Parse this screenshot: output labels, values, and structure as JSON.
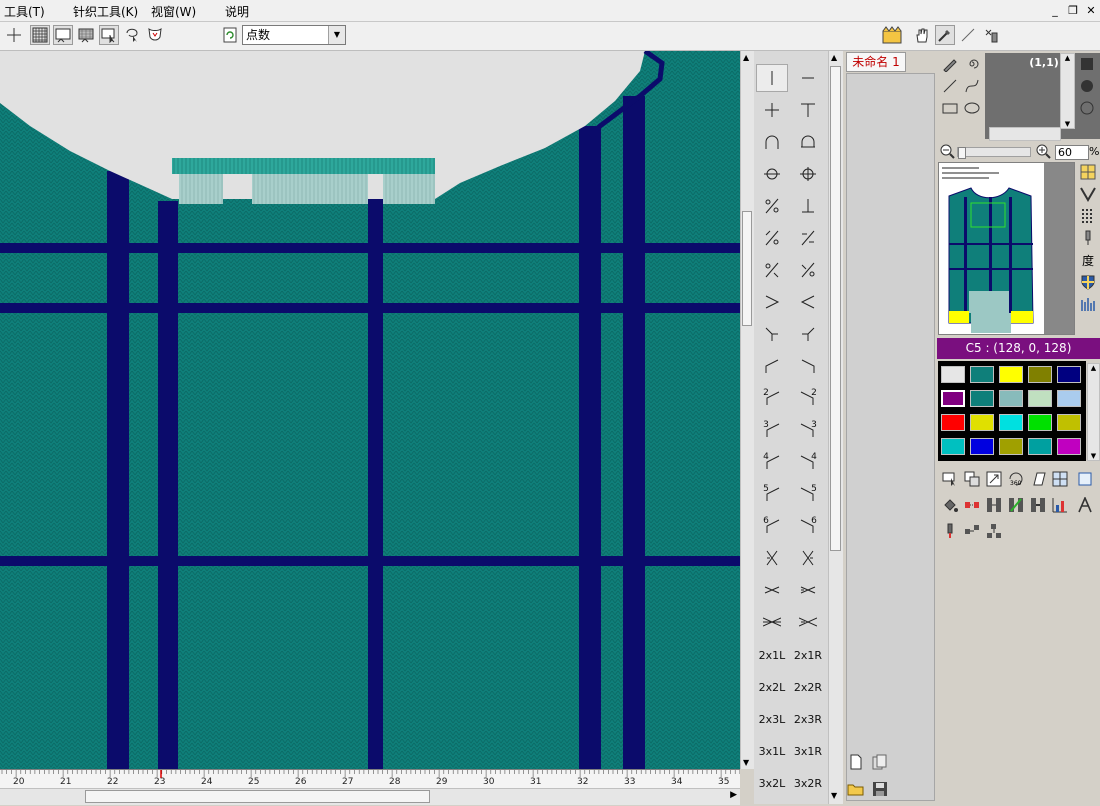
{
  "menu": {
    "items": [
      "工具(T)",
      "针织工具(K)",
      "视窗(W)",
      "说明"
    ],
    "window_controls": [
      "minimize",
      "restore",
      "close"
    ]
  },
  "toolbar": {
    "left_icons": [
      "crosshair-icon",
      "grid-icon",
      "window-select-icon",
      "pattern-fill-icon",
      "arrow-select-icon",
      "lasso-icon",
      "shield-pattern-icon"
    ],
    "pressed": [
      "grid-icon",
      "window-select-icon"
    ],
    "combo_value": "点数",
    "right_icons": [
      "gift-box-icon",
      "hand-icon",
      "eyedropper-icon",
      "line-icon",
      "stitch-tool-icon"
    ]
  },
  "ruler": {
    "labels": [
      "20",
      "21",
      "22",
      "23",
      "24",
      "25",
      "26",
      "27",
      "28",
      "29",
      "30",
      "31",
      "32",
      "33",
      "34",
      "35"
    ]
  },
  "stitch_palette": {
    "items": [
      "",
      "",
      "",
      "",
      "",
      "",
      "",
      "",
      "",
      "",
      "",
      "",
      "",
      "",
      "",
      "",
      "",
      "",
      "",
      "",
      "",
      "",
      "",
      "",
      "2",
      "2",
      "3",
      "3",
      "4",
      "4",
      "5",
      "5",
      "6",
      "6",
      "",
      "",
      "",
      "",
      "",
      "",
      "2x1L",
      "2x1R",
      "2x2L",
      "2x2R",
      "2x3L",
      "2x3R",
      "3x1L",
      "3x1R",
      "3x2L",
      "3x2R"
    ]
  },
  "documents": {
    "tab_label": "未命名 1"
  },
  "right_panel": {
    "coord": "(1,1)",
    "zoom": "60",
    "zoom_unit": "%",
    "selected_color_label": "C5 : (128, 0, 128)",
    "colors": [
      "#e6e6e6",
      "#0f7f7a",
      "#ffff00",
      "#808000",
      "#000080",
      "#800080",
      "#0f7f7a",
      "#88bbbb",
      "#c0e0c0",
      "#aaccee",
      "#ff0000",
      "#e0e000",
      "#00e0e0",
      "#00e000",
      "#c0c000",
      "#00c0c0",
      "#0000e0",
      "#a0a000",
      "#00a0a0",
      "#c000c0"
    ],
    "selected_index": 5
  },
  "colors": {
    "fabric": "#0f7f7a",
    "stripe": "#0b0b6b",
    "neck_bg": "#e1e1e1",
    "rib": "#2ea89c",
    "rib_light": "#9cc8c4"
  }
}
